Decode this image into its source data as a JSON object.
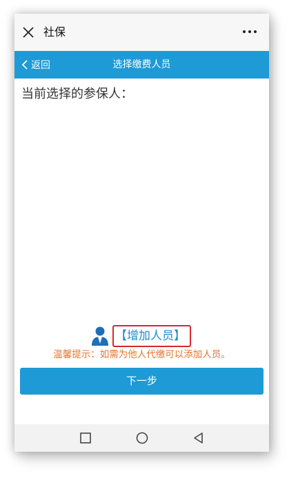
{
  "wechat_bar": {
    "close_icon": "close-icon",
    "title": "社保",
    "more_icon": "more-icon"
  },
  "nav": {
    "back_label": "返回",
    "title": "选择缴费人员"
  },
  "main": {
    "selected_label": "当前选择的参保人：",
    "add_button_label": "【增加人员】",
    "hint": "温馨提示：如需为他人代缴可以添加人员。",
    "next_button_label": "下一步"
  },
  "system_nav": {
    "icons": [
      "square-icon",
      "circle-icon",
      "triangle-back-icon"
    ]
  },
  "colors": {
    "accent": "#1e9ad6",
    "hint": "#e8732d",
    "highlight_border": "#d8262c"
  }
}
